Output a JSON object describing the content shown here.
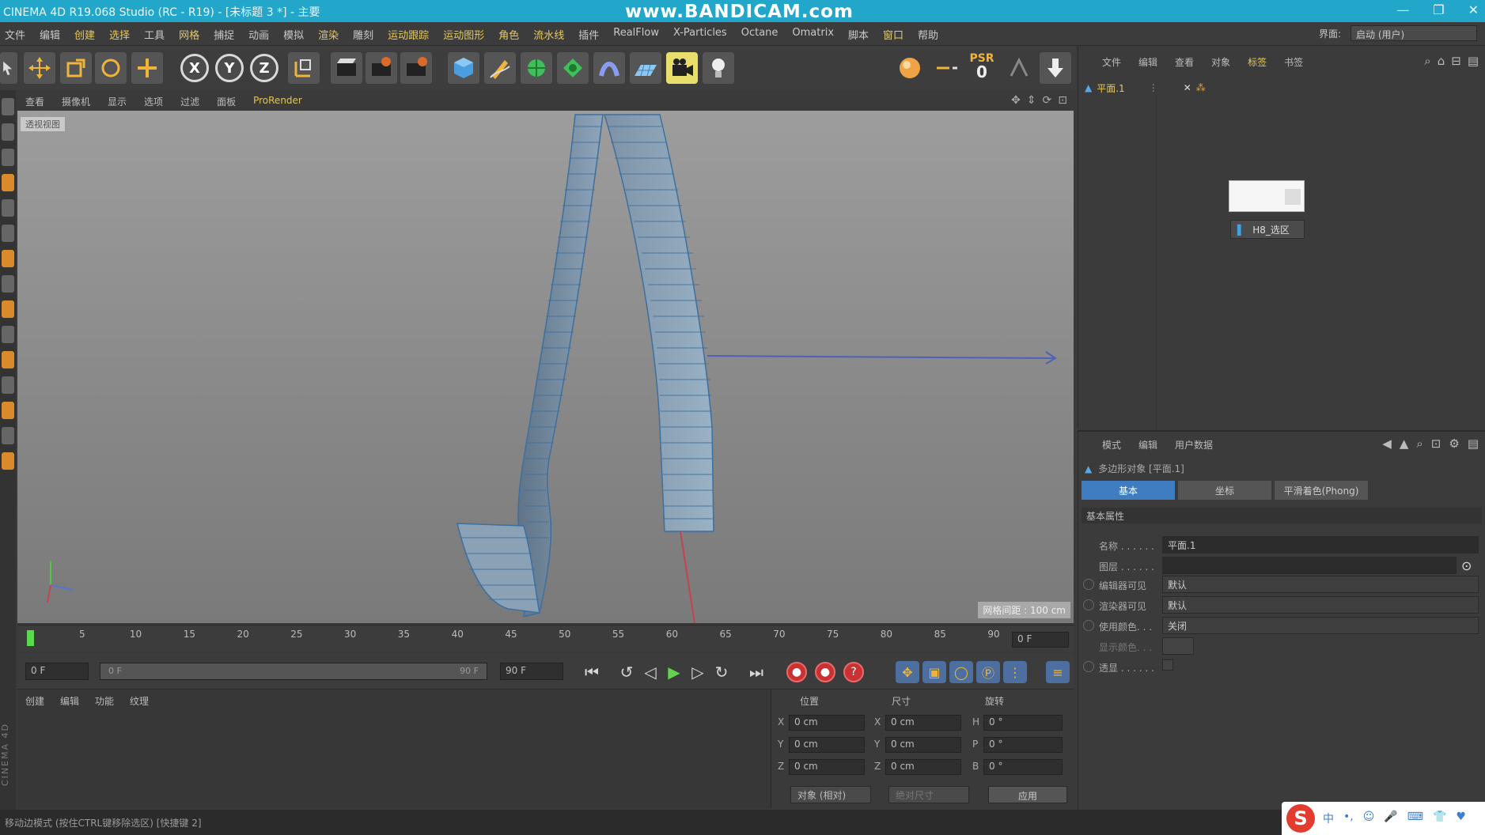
{
  "window": {
    "title": "CINEMA 4D R19.068 Studio (RC - R19) - [未标题 3 *] - 主要",
    "watermark": "www.BANDICAM.com",
    "minimize": "—",
    "restore": "❐",
    "close": "✕"
  },
  "menubar": {
    "items": [
      "文件",
      "编辑",
      "创建",
      "选择",
      "工具",
      "网格",
      "捕捉",
      "动画",
      "模拟",
      "渲染",
      "雕刻",
      "运动跟踪",
      "运动图形",
      "角色",
      "流水线",
      "插件",
      "RealFlow",
      "X-Particles",
      "Octane",
      "Omatrix",
      "脚本",
      "窗口",
      "帮助"
    ],
    "layout_label": "界面:",
    "layout_value": "启动 (用户)"
  },
  "toolbar": {
    "axis_x": "X",
    "axis_y": "Y",
    "axis_z": "Z",
    "psr_label": "PSR",
    "psr_value": "0"
  },
  "viewport_menu": {
    "items": [
      "查看",
      "摄像机",
      "显示",
      "选项",
      "过滤",
      "面板"
    ],
    "prorender": "ProRender",
    "label": "透视视图",
    "grid_distance": "网格间距 : 100 cm"
  },
  "timeline": {
    "ticks": [
      "0",
      "5",
      "10",
      "15",
      "20",
      "25",
      "30",
      "35",
      "40",
      "45",
      "50",
      "55",
      "60",
      "65",
      "70",
      "75",
      "80",
      "85",
      "90"
    ],
    "current_frame": "0 F"
  },
  "transport": {
    "start_field": "0 F",
    "range_start": "0 F",
    "range_end": "90 F",
    "end_field": "90 F"
  },
  "material_panel": {
    "menu": [
      "创建",
      "编辑",
      "功能",
      "纹理"
    ]
  },
  "coordinates": {
    "headers": [
      "位置",
      "尺寸",
      "旋转"
    ],
    "axis_labels": [
      "X",
      "Y",
      "Z"
    ],
    "rot_labels": [
      "H",
      "P",
      "B"
    ],
    "position": [
      "0 cm",
      "0 cm",
      "0 cm"
    ],
    "size": [
      "0 cm",
      "0 cm",
      "0 cm"
    ],
    "rotation": [
      "0 °",
      "0 °",
      "0 °"
    ],
    "mode_dropdown": "对象 (相对)",
    "size_dropdown": "绝对尺寸",
    "apply": "应用"
  },
  "object_manager": {
    "menu": [
      "文件",
      "编辑",
      "查看",
      "对象",
      "标签",
      "书签"
    ],
    "object_name": "平面.1",
    "tag_name": "H8_选区"
  },
  "attribute_manager": {
    "menu": [
      "模式",
      "编辑",
      "用户数据"
    ],
    "object_title": "多边形对象 [平面.1]",
    "tabs": [
      "基本",
      "坐标",
      "平滑着色(Phong)"
    ],
    "section": "基本属性",
    "rows": [
      {
        "label": "名称 . . . . . .",
        "value": "平面.1"
      },
      {
        "label": "图层 . . . . . .",
        "value": ""
      },
      {
        "label": "编辑器可见",
        "value": "默认"
      },
      {
        "label": "渲染器可见",
        "value": "默认"
      },
      {
        "label": "使用颜色. . .",
        "value": "关闭"
      },
      {
        "label": "显示颜色. . .",
        "value": ""
      },
      {
        "label": "透显 . . . . . .",
        "value": ""
      }
    ]
  },
  "statusbar": {
    "message": "移动边模式 (按住CTRL键移除选区) [快捷键 2]"
  },
  "tray": {
    "logo": "S",
    "items": [
      "中",
      "•,",
      "☺",
      "🎤",
      "⌨",
      "👕",
      "♥"
    ]
  },
  "sidebar": {
    "brand": "CINEMA 4D"
  },
  "colors": {
    "titlebar": "#22a6c9",
    "accent_blue": "#3f7cc0",
    "highlight_yellow": "#e3c65b",
    "play_green": "#62d14f",
    "record_red": "#c93232"
  }
}
